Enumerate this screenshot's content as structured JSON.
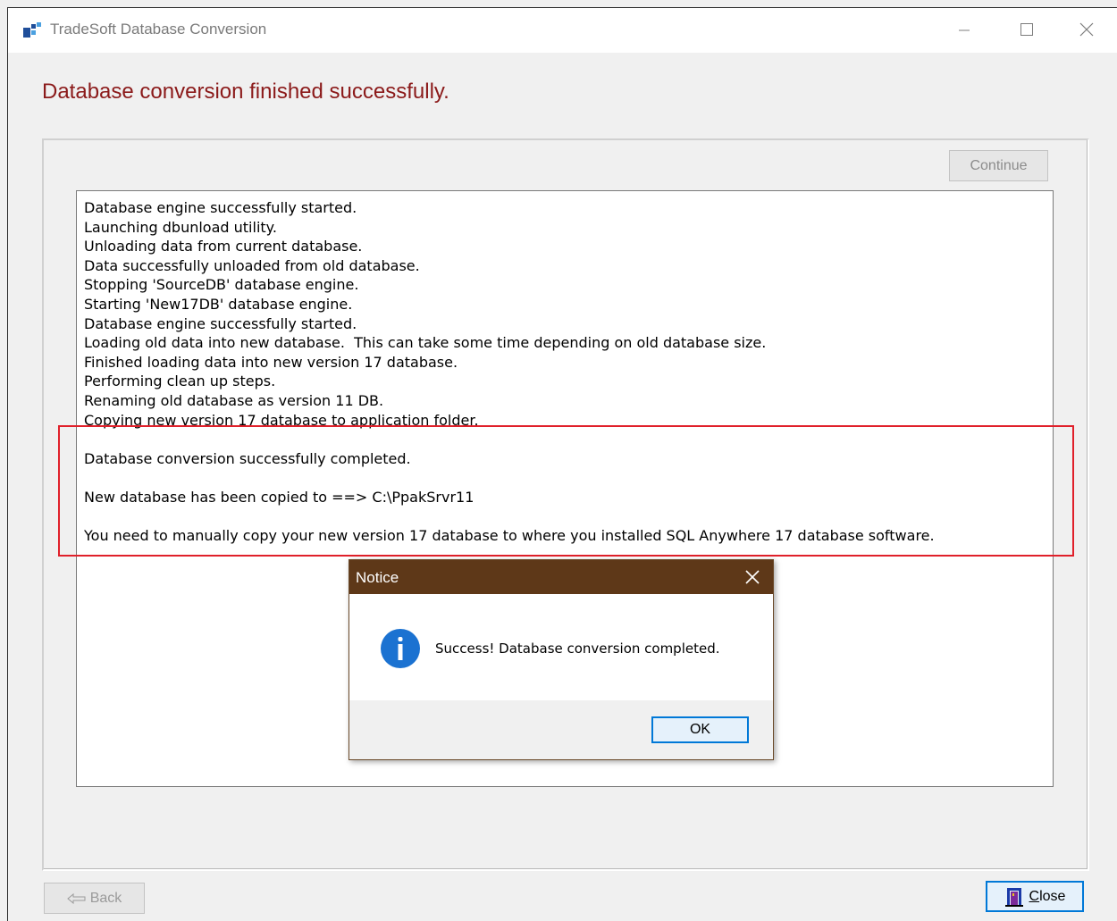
{
  "window": {
    "title": "TradeSoft Database Conversion",
    "heading": "Database conversion finished successfully."
  },
  "toolbar": {
    "continue_label": "Continue"
  },
  "log": {
    "lines": [
      "Database engine successfully started.",
      "Launching dbunload utility.",
      "Unloading data from current database.",
      "Data successfully unloaded from old database.",
      "Stopping 'SourceDB' database engine.",
      "Starting 'New17DB' database engine.",
      "Database engine successfully started.",
      "Loading old data into new database.  This can take some time depending on old database size.",
      "Finished loading data into new version 17 database.",
      "Performing clean up steps.",
      "Renaming old database as version 11 DB.",
      "Copying new version 17 database to application folder.",
      "",
      "Database conversion successfully completed.",
      "",
      "New database has been copied to ==> C:\\PpakSrvr11",
      "",
      "You need to manually copy your new version 17 database to where you installed SQL Anywhere 17 database software."
    ]
  },
  "dialog": {
    "title": "Notice",
    "message": "Success!  Database conversion completed.",
    "ok_label": "OK",
    "icon": "info-icon"
  },
  "footer": {
    "back_label": "Back",
    "close_label_underlined": "C",
    "close_label_rest": "lose"
  },
  "colors": {
    "heading": "#8b1a1a",
    "dialog_titlebar": "#5e3818",
    "highlight_box": "#e0202a",
    "focus_border": "#0078d7"
  }
}
